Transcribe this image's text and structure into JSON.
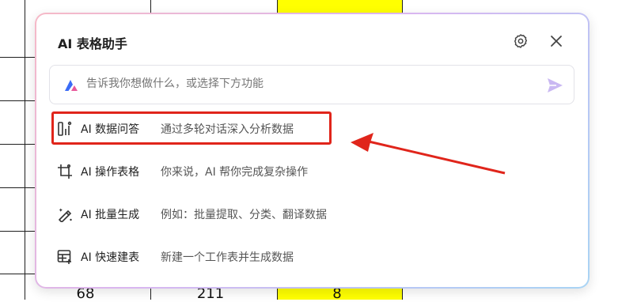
{
  "panel": {
    "title": "AI 表格助手",
    "icons": {
      "settings": "gear-icon",
      "close": "close-icon"
    }
  },
  "input": {
    "placeholder": "告诉我你想做什么，或选择下方功能",
    "icons": {
      "logo": "assistant-logo-icon",
      "send": "send-icon"
    }
  },
  "menu": {
    "items": [
      {
        "label": "AI 数据问答",
        "description": "通过多轮对话深入分析数据",
        "icon": "data-chart-icon"
      },
      {
        "label": "AI 操作表格",
        "description": "你来说，AI 帮你完成复杂操作",
        "icon": "crop-table-icon"
      },
      {
        "label": "AI 批量生成",
        "description": "例如：批量提取、分类、翻译数据",
        "icon": "magic-pen-icon"
      },
      {
        "label": "AI 快速建表",
        "description": "新建一个工作表并生成数据",
        "icon": "new-table-icon"
      }
    ]
  },
  "sheet": {
    "visible_row_values": [
      "68",
      "211",
      "8"
    ],
    "highlight_column_color": "#ffff00"
  },
  "colors": {
    "annotation_red": "#e0251b",
    "send_icon": "#c9b8f2",
    "logo_blue": "#3b6cf6",
    "logo_pink": "#e8589a"
  }
}
